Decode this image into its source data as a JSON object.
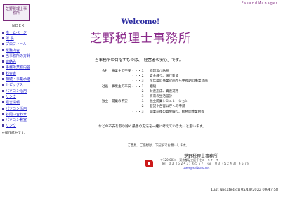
{
  "header": {
    "logo_text": "芝野税理士事務所",
    "brand": "FasandManager",
    "welcome": "Welcome!",
    "title": "芝野税理士事務所"
  },
  "sidebar": {
    "index_title": "INDEX",
    "items": [
      {
        "label": "ホームページ"
      },
      {
        "label": "所 長"
      },
      {
        "label": "プロフィール"
      },
      {
        "label": "業務内容"
      },
      {
        "label": "当事務所の方針"
      },
      {
        "label": "連絡先"
      },
      {
        "label": "事務所業務内容"
      },
      {
        "label": "料金表"
      },
      {
        "label": "相続・事業承継"
      },
      {
        "label": "トピックス"
      },
      {
        "label": "パソコン活用"
      },
      {
        "label": "リンク"
      },
      {
        "label": "経営情報"
      },
      {
        "label": "パソコン活用"
      },
      {
        "label": "お問い合わせ"
      },
      {
        "label": "パソコン教室"
      },
      {
        "label": "リンク"
      }
    ],
    "note": "←部作成中です。"
  },
  "main": {
    "motto": "当事務所の目指すものは、「経営者の安心」です。",
    "rows": [
      {
        "category": "会社・事業主の不安",
        "num": "・・・１．",
        "text": "経理及び納税"
      },
      {
        "category": "",
        "num": "・・・２．",
        "text": "資金繰り、銀行対策"
      },
      {
        "category": "",
        "num": "・・・３．",
        "text": "次年度の事業計画から中長期の事業計画"
      },
      {
        "category": "社長・事業主の不安",
        "num": "・・・１．",
        "text": "相続"
      },
      {
        "category": "",
        "num": "・・・２．",
        "text": "財産形成、資産運用"
      },
      {
        "category": "",
        "num": "・・・３．",
        "text": "将来の生活設計"
      },
      {
        "category": "独立・開業の不安",
        "num": "・・・１．",
        "text": "独立開業シミュレーション"
      },
      {
        "category": "",
        "num": "・・・２．",
        "text": "登記や各官公庁への申請"
      },
      {
        "category": "",
        "num": "・・・３．",
        "text": "開業前後の資金繰り、総務関連業務等"
      }
    ],
    "closing": "などの不安を取り除く最善の方法を一緒に考えていきたいと思います。",
    "contact_line": "ご意見、ご感想は、下記までお願いします。"
  },
  "footer": {
    "office": "芝野税理士事務所",
    "address": "〒120-0034　東京都足立区千住３－５７－７",
    "tel": "Tel　０３（５２４３）６５７７　Fax　０３（５２４３）６５７８",
    "email": "taxes@shibano.net",
    "updated": "Last updated on 05/18/2022 00:47:58"
  },
  "colors": {
    "title": "#8a2a8a",
    "welcome": "#2a2aa0",
    "link": "#1a1acc",
    "emblem": "#cc1a1a"
  }
}
